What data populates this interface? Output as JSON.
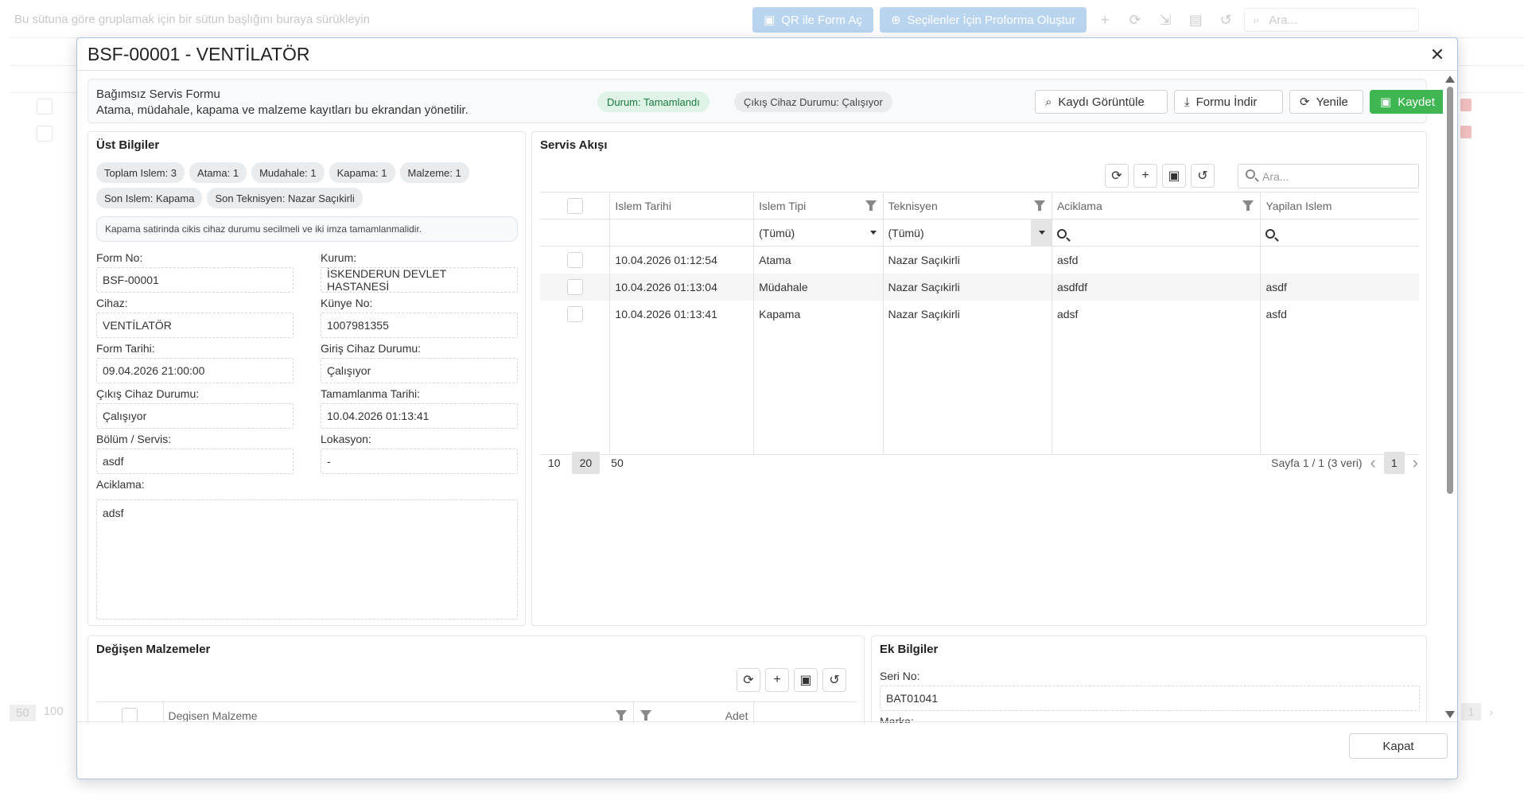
{
  "background": {
    "group_hint": "Bu sütuna göre gruplamak için bir sütun başlığını buraya sürükleyin",
    "qr_button": "QR ile Form Aç",
    "proforma_button": "Seçilenler İçin Proforma Oluştur",
    "search_placeholder": "Ara...",
    "pager": [
      "50",
      "100"
    ],
    "page": "1"
  },
  "dialog": {
    "title": "BSF-00001 - VENTİLATÖR",
    "close_label": "Kapat"
  },
  "info": {
    "line1": "Bağımsız Servis Formu",
    "line2": "Atama, müdahale, kapama ve malzeme kayıtları bu ekrandan yönetilir.",
    "status_pill": "Durum: Tamamlandı",
    "exit_pill": "Çıkış Cihaz Durumu: Çalışıyor",
    "view_button": "Kaydı Görüntüle",
    "download_button": "Formu İndir",
    "refresh_button": "Yenile",
    "save_button": "Kaydet",
    "colors": {
      "save": "#3fb652",
      "status_bg": "#dff3e6",
      "status_fg": "#1b7a3e"
    }
  },
  "ust": {
    "title": "Üst Bilgiler",
    "chips": [
      "Toplam Islem: 3",
      "Atama: 1",
      "Mudahale: 1",
      "Kapama: 1",
      "Malzeme: 1",
      "Son Islem: Kapama",
      "Son Teknisyen: Nazar Saçıkirli"
    ],
    "note": "Kapama satirinda cikis cihaz durumu secilmeli ve iki imza tamamlanmalidir.",
    "fields": {
      "form_no_label": "Form No:",
      "form_no": "BSF-00001",
      "kurum_label": "Kurum:",
      "kurum": "İSKENDERUN DEVLET HASTANESİ",
      "cihaz_label": "Cihaz:",
      "cihaz": "VENTİLATÖR",
      "kunye_label": "Künye No:",
      "kunye": "1007981355",
      "form_tarihi_label": "Form Tarihi:",
      "form_tarihi": "09.04.2026 21:00:00",
      "giris_label": "Giriş Cihaz Durumu:",
      "giris": "Çalışıyor",
      "cikis_label": "Çıkış Cihaz Durumu:",
      "cikis": "Çalışıyor",
      "tamamlanma_label": "Tamamlanma Tarihi:",
      "tamamlanma": "10.04.2026 01:13:41",
      "bolum_label": "Bölüm / Servis:",
      "bolum": "asdf",
      "lokasyon_label": "Lokasyon:",
      "lokasyon": "-",
      "aciklama_label": "Aciklama:",
      "aciklama": "adsf"
    }
  },
  "servis": {
    "title": "Servis Akışı",
    "search_placeholder": "Ara...",
    "columns": [
      "Islem Tarihi",
      "Islem Tipi",
      "Teknisyen",
      "Aciklama",
      "Yapilan Islem"
    ],
    "filter_all": "(Tümü)",
    "rows": [
      [
        "10.04.2026 01:12:54",
        "Atama",
        "Nazar Saçıkirli",
        "asfd",
        ""
      ],
      [
        "10.04.2026 01:13:04",
        "Müdahale",
        "Nazar Saçıkirli",
        "asdfdf",
        "asdf"
      ],
      [
        "10.04.2026 01:13:41",
        "Kapama",
        "Nazar Saçıkirli",
        "adsf",
        "asfd"
      ]
    ],
    "page_sizes": [
      "10",
      "20",
      "50"
    ],
    "page_info": "Sayfa 1 / 1 (3 veri)",
    "page": "1"
  },
  "degisen": {
    "title": "Değişen Malzemeler",
    "columns": [
      "Degisen Malzeme",
      "Adet"
    ]
  },
  "ek": {
    "title": "Ek Bilgiler",
    "seri_label": "Seri No:",
    "seri": "BAT01041",
    "marka_label": "Marka:"
  }
}
